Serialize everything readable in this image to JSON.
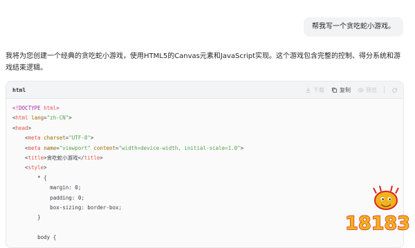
{
  "user_message": "帮我写一个贪吃蛇小游戏。",
  "reply_text": "我将为您创建一个经典的贪吃蛇小游戏，使用HTML5的Canvas元素和JavaScript实现。这个游戏包含完整的控制、得分系统和游戏结束逻辑。",
  "code_block": {
    "language": "html",
    "toolbar": {
      "download_label": "下载",
      "copy_label": "复制",
      "preview_label": "预览"
    },
    "lines": [
      [
        [
          "<!DOCTYPE ",
          "kw"
        ],
        [
          "html",
          "tag"
        ],
        [
          ">",
          "kw"
        ]
      ],
      [
        [
          "<",
          "p"
        ],
        [
          "html",
          "tag"
        ],
        [
          " ",
          "p"
        ],
        [
          "lang",
          "attr"
        ],
        [
          "=",
          "p"
        ],
        [
          "\"zh-CN\"",
          "str"
        ],
        [
          ">",
          "p"
        ]
      ],
      [
        [
          "<",
          "p"
        ],
        [
          "head",
          "tag"
        ],
        [
          ">",
          "p"
        ]
      ],
      [
        [
          "    <",
          "p"
        ],
        [
          "meta",
          "tag"
        ],
        [
          " ",
          "p"
        ],
        [
          "charset",
          "attr"
        ],
        [
          "=",
          "p"
        ],
        [
          "\"UTF-8\"",
          "str"
        ],
        [
          ">",
          "p"
        ]
      ],
      [
        [
          "    <",
          "p"
        ],
        [
          "meta",
          "tag"
        ],
        [
          " ",
          "p"
        ],
        [
          "name",
          "attr"
        ],
        [
          "=",
          "p"
        ],
        [
          "\"viewport\"",
          "str"
        ],
        [
          " ",
          "p"
        ],
        [
          "content",
          "attr"
        ],
        [
          "=",
          "p"
        ],
        [
          "\"width=device-width, initial-scale=1.0\"",
          "str"
        ],
        [
          ">",
          "p"
        ]
      ],
      [
        [
          "    <",
          "p"
        ],
        [
          "title",
          "tag"
        ],
        [
          ">贪吃蛇小游戏</",
          "p"
        ],
        [
          "title",
          "tag"
        ],
        [
          ">",
          "p"
        ]
      ],
      [
        [
          "    <",
          "p"
        ],
        [
          "style",
          "tag"
        ],
        [
          ">",
          "p"
        ]
      ],
      [
        [
          "        * {",
          "p"
        ]
      ],
      [
        [
          "            margin: 0;",
          "p"
        ]
      ],
      [
        [
          "            padding: 0;",
          "p"
        ]
      ],
      [
        [
          "            box-sizing: border-box;",
          "p"
        ]
      ],
      [
        [
          "        }",
          "p"
        ]
      ],
      [
        [
          "",
          "p"
        ]
      ],
      [
        [
          "        body {",
          "p"
        ]
      ]
    ]
  },
  "watermark": {
    "text": "18183",
    "colors": {
      "fill": "#f2b21c",
      "stroke": "#d9251d",
      "shadow": "#8a4b10"
    }
  },
  "colors": {
    "tag": "#e45649",
    "attr": "#986801",
    "string": "#50a14f",
    "keyword": "#a626a4",
    "plain": "#383a42"
  }
}
